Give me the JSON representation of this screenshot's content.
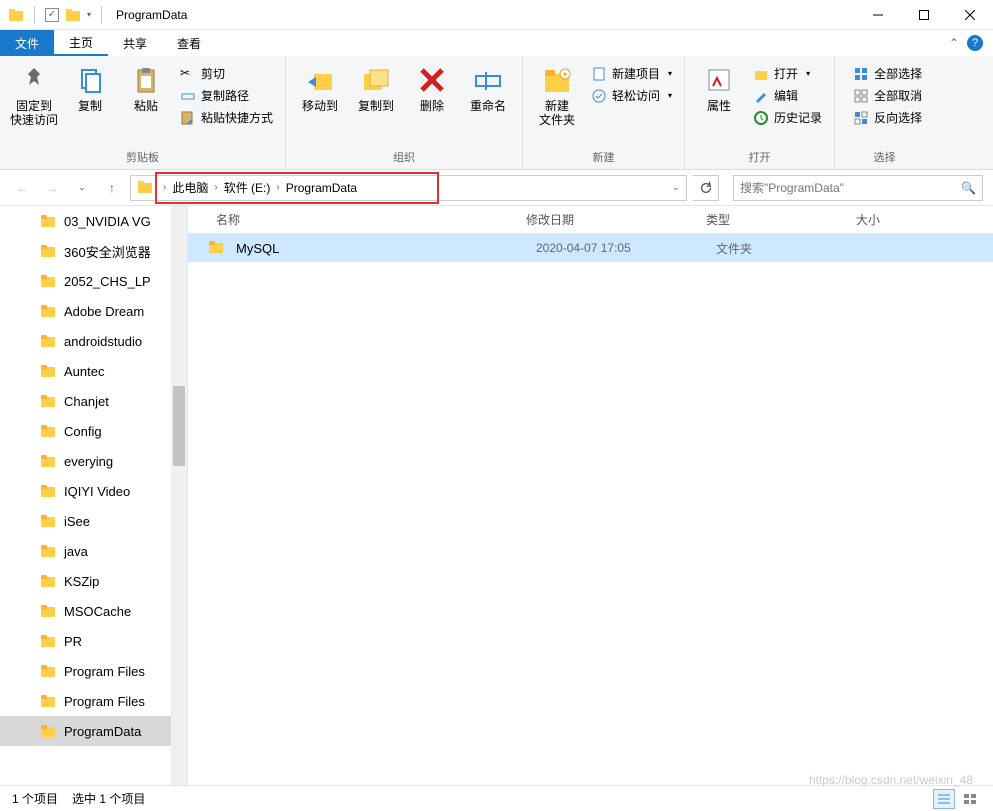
{
  "window": {
    "title": "ProgramData"
  },
  "tabs": {
    "file": "文件",
    "home": "主页",
    "share": "共享",
    "view": "查看"
  },
  "ribbon": {
    "clipboard": {
      "label": "剪贴板",
      "pin": "固定到\n快速访问",
      "copy": "复制",
      "paste": "粘贴",
      "cut": "剪切",
      "copypath": "复制路径",
      "pasteshortcut": "粘贴快捷方式"
    },
    "organize": {
      "label": "组织",
      "moveto": "移动到",
      "copyto": "复制到",
      "delete": "删除",
      "rename": "重命名"
    },
    "new": {
      "label": "新建",
      "newfolder": "新建\n文件夹",
      "newitem": "新建项目",
      "easyaccess": "轻松访问"
    },
    "open": {
      "label": "打开",
      "properties": "属性",
      "open": "打开",
      "edit": "编辑",
      "history": "历史记录"
    },
    "select": {
      "label": "选择",
      "selectall": "全部选择",
      "selectnone": "全部取消",
      "invert": "反向选择"
    }
  },
  "breadcrumb": {
    "pc": "此电脑",
    "drive": "软件 (E:)",
    "folder": "ProgramData"
  },
  "search": {
    "placeholder": "搜索\"ProgramData\""
  },
  "columns": {
    "name": "名称",
    "date": "修改日期",
    "type": "类型",
    "size": "大小"
  },
  "tree": [
    "03_NVIDIA VG",
    "360安全浏览器",
    "2052_CHS_LP",
    "Adobe Dream",
    "androidstudio",
    "Auntec",
    "Chanjet",
    "Config",
    "everying",
    "IQIYI Video",
    "iSee",
    "java",
    "KSZip",
    "MSOCache",
    "PR",
    "Program Files",
    "Program Files",
    "ProgramData"
  ],
  "tree_selected_index": 17,
  "files": [
    {
      "name": "MySQL",
      "date": "2020-04-07 17:05",
      "type": "文件夹"
    }
  ],
  "status": {
    "count": "1 个项目",
    "selected": "选中 1 个项目"
  },
  "watermark": "https://blog.csdn.net/weixin_48"
}
